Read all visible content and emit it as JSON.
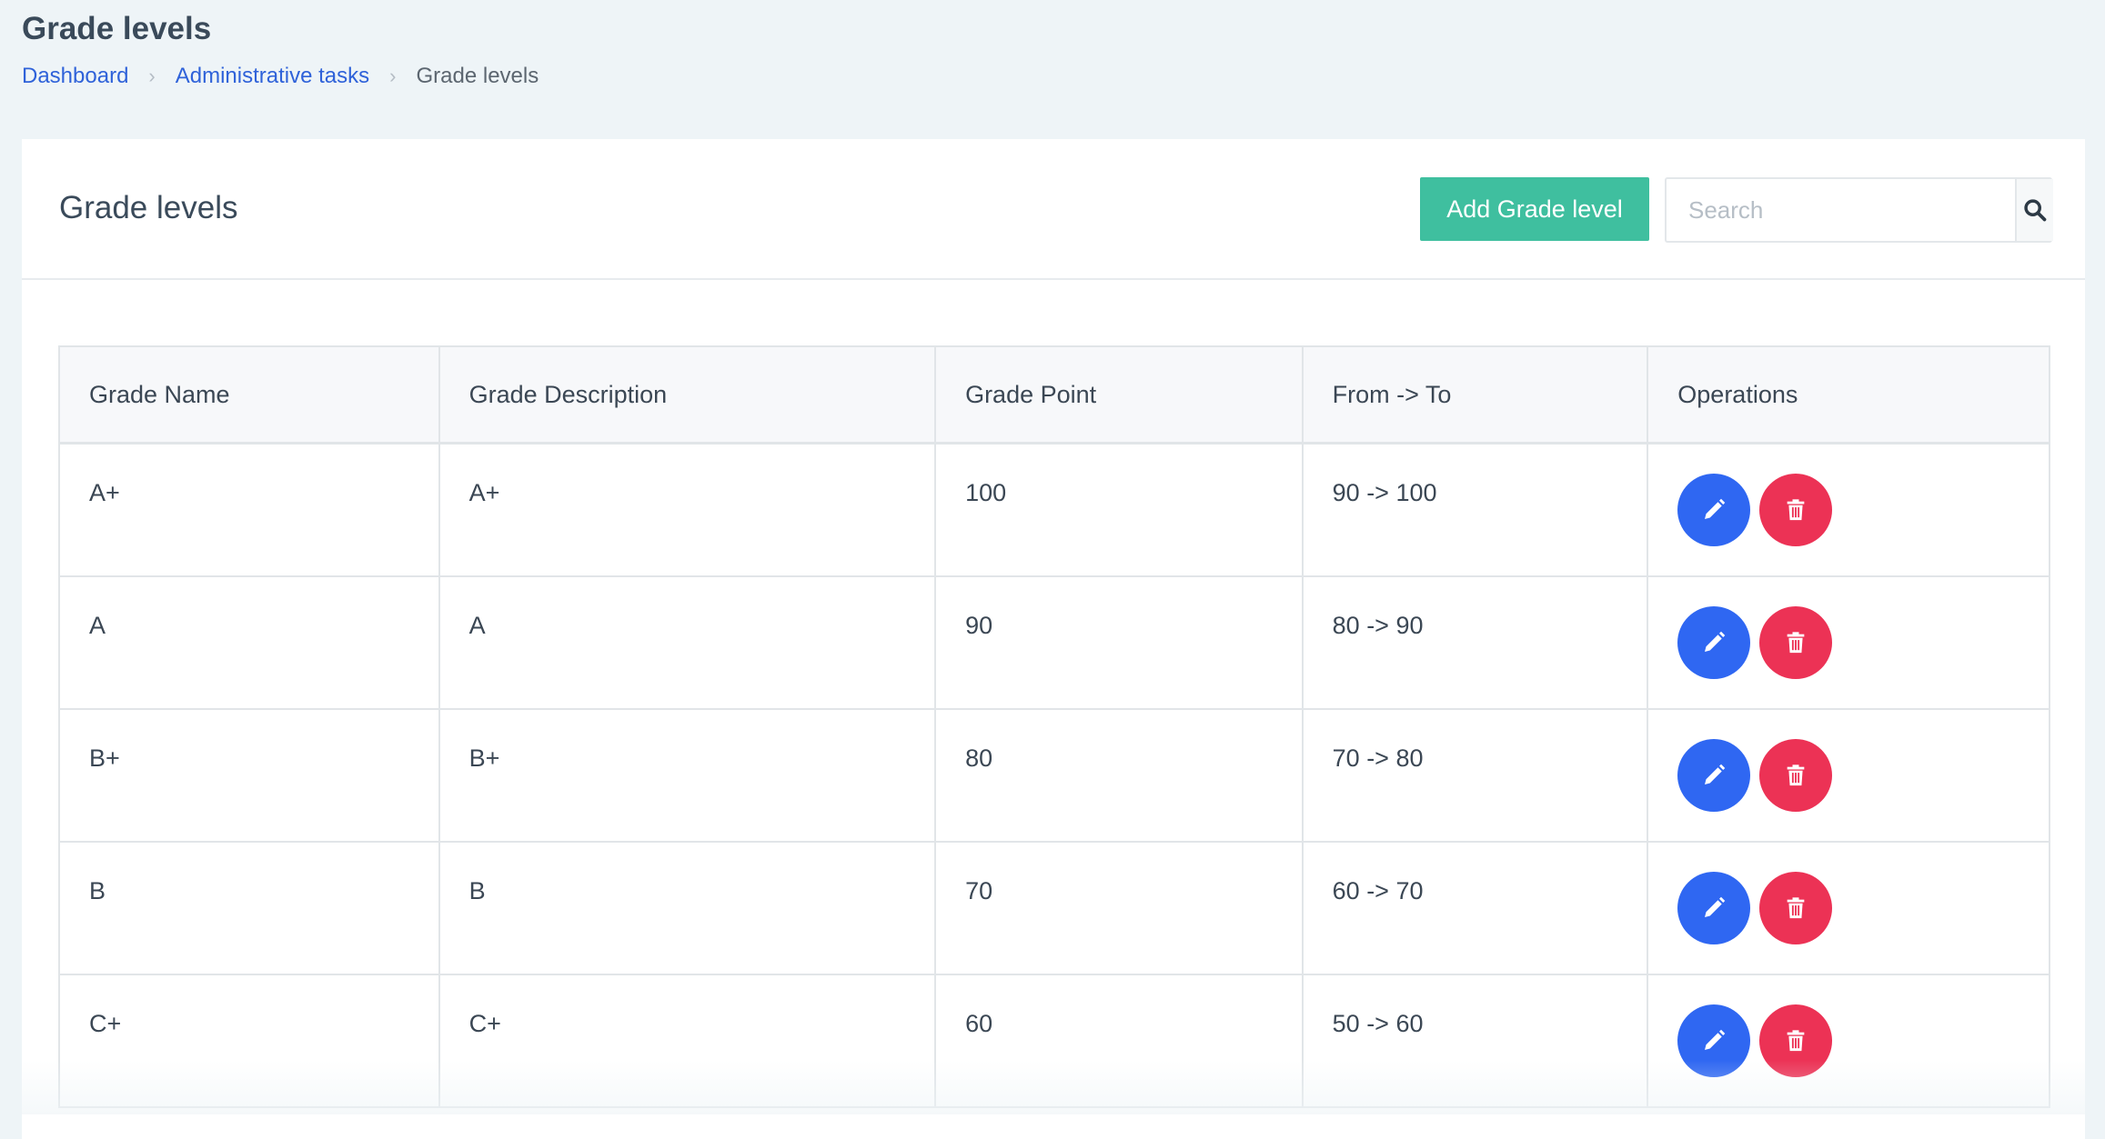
{
  "page": {
    "title": "Grade levels"
  },
  "breadcrumb": {
    "items": [
      {
        "label": "Dashboard"
      },
      {
        "label": "Administrative tasks"
      },
      {
        "label": "Grade levels"
      }
    ]
  },
  "card": {
    "title": "Grade levels",
    "add_button_label": "Add Grade level",
    "search_placeholder": "Search",
    "search_value": ""
  },
  "table": {
    "headers": [
      "Grade Name",
      "Grade Description",
      "Grade Point",
      "From -> To",
      "Operations"
    ],
    "rows": [
      {
        "name": "A+",
        "description": "A+",
        "point": "100",
        "range": "90 -> 100"
      },
      {
        "name": "A",
        "description": "A",
        "point": "90",
        "range": "80 -> 90"
      },
      {
        "name": "B+",
        "description": "B+",
        "point": "80",
        "range": "70 -> 80"
      },
      {
        "name": "B",
        "description": "B",
        "point": "70",
        "range": "60 -> 70"
      },
      {
        "name": "C+",
        "description": "C+",
        "point": "60",
        "range": "50 -> 60"
      }
    ]
  },
  "icons": {
    "search": "search-icon",
    "edit": "pencil-icon",
    "delete": "trash-icon",
    "separator": "chevron-right-icon"
  },
  "colors": {
    "accent_green": "#3fbf9f",
    "edit_blue": "#2f67f2",
    "delete_red": "#ec3255",
    "link_blue": "#2f62d9",
    "page_background": "#eef4f7"
  }
}
